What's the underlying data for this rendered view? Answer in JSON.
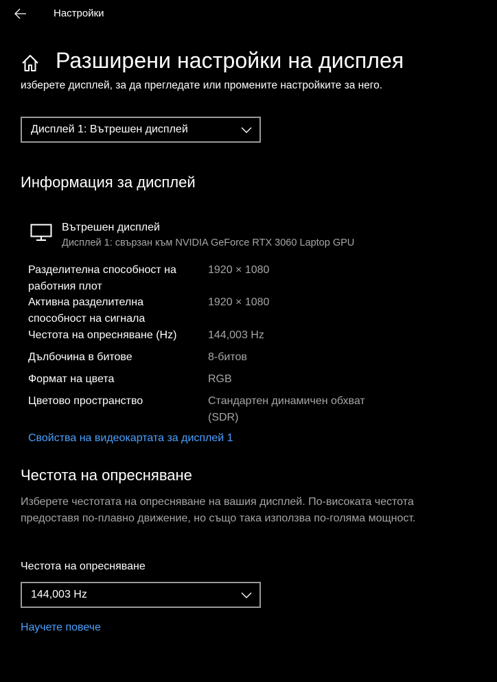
{
  "window": {
    "title": "Настройки"
  },
  "page": {
    "title": "Разширени настройки на дисплея",
    "intro": "изберете дисплей, за да прегледате или промените настройките за него."
  },
  "display_select": {
    "selected": "Дисплей 1: Вътрешен дисплей"
  },
  "display_info": {
    "heading": "Информация за дисплей",
    "name": "Вътрешен дисплей",
    "connection": "Дисплей 1: свързан към NVIDIA GeForce RTX 3060 Laptop GPU",
    "rows": [
      {
        "label": "Разделителна способност на работния плот",
        "value": "1920 × 1080"
      },
      {
        "label": "Активна разделителна способност на сигнала",
        "value": "1920 × 1080"
      },
      {
        "label": "Честота на опресняване (Hz)",
        "value": "144,003 Hz"
      },
      {
        "label": "Дълбочина в битове",
        "value": "8-битов"
      },
      {
        "label": "Формат на цвета",
        "value": "RGB"
      },
      {
        "label": "Цветово пространство",
        "value": "Стандартен динамичен обхват (SDR)"
      }
    ],
    "adapter_link": "Свойства на видеокартата за дисплей 1"
  },
  "refresh": {
    "heading": "Честота на опресняване",
    "description": "Изберете честотата на опресняване на вашия дисплей. По-високата честота предоставя по-плавно движение, но също така използва по-голяма мощност.",
    "field_label": "Честота на опресняване",
    "selected": "144,003 Hz",
    "learn_more": "Научете повече"
  },
  "icons": {
    "back": "back-arrow-icon",
    "home": "home-icon",
    "monitor": "monitor-icon",
    "chevron": "chevron-down-icon"
  },
  "colors": {
    "background": "#000000",
    "text": "#ffffff",
    "secondary_text": "#a6a6a6",
    "link": "#4ba0ff",
    "dropdown_border": "#9a9a9a"
  }
}
